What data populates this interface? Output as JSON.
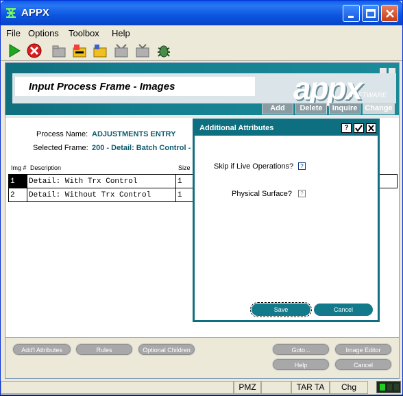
{
  "window": {
    "title": "APPX"
  },
  "menu": {
    "items": [
      "File",
      "Options",
      "Toolbox",
      "Help"
    ]
  },
  "toolbar": {
    "icons": [
      "run-icon",
      "stop-icon",
      "folder-icon",
      "folder-edit-icon",
      "folder-open-icon",
      "folder-gray-icon",
      "folder-tv-icon",
      "bug-icon"
    ]
  },
  "banner": {
    "title": "Input Process Frame - Images",
    "logo": "appx",
    "logo_sub": "SOFTWARE",
    "modes": [
      "Add",
      "Delete",
      "Inquire",
      "Change"
    ]
  },
  "form": {
    "process_label": "Process Name:",
    "process_value": "ADJUSTMENTS ENTRY",
    "frame_label": "Selected Frame:",
    "frame_value": "200 - Detail: Batch Control -"
  },
  "grid": {
    "headers": {
      "img": "Img #",
      "desc": "Description",
      "size": "Size"
    },
    "rows": [
      {
        "num": "1",
        "desc": "Detail: With Trx Control",
        "size": "1"
      },
      {
        "num": "2",
        "desc": "Detail: Without Trx Control",
        "size": "1"
      }
    ]
  },
  "bottom_buttons": {
    "addl": "Add'l Attributes",
    "rules": "Rules",
    "optional": "Optional Children",
    "goto": "Goto...",
    "image_editor": "Image Editor",
    "help": "Help",
    "cancel": "Cancel"
  },
  "dialog": {
    "title": "Additional Attributes",
    "skip_label": "Skip if Live Operations?",
    "skip_value": "?",
    "physical_label": "Physical Surface?",
    "physical_value": "?",
    "save": "Save",
    "cancel": "Cancel"
  },
  "status": {
    "cells": [
      "PMZ",
      "TAR TA",
      "Chg"
    ]
  },
  "colors": {
    "accent": "#0e6f80",
    "title_bar": "#0a5fe8"
  }
}
